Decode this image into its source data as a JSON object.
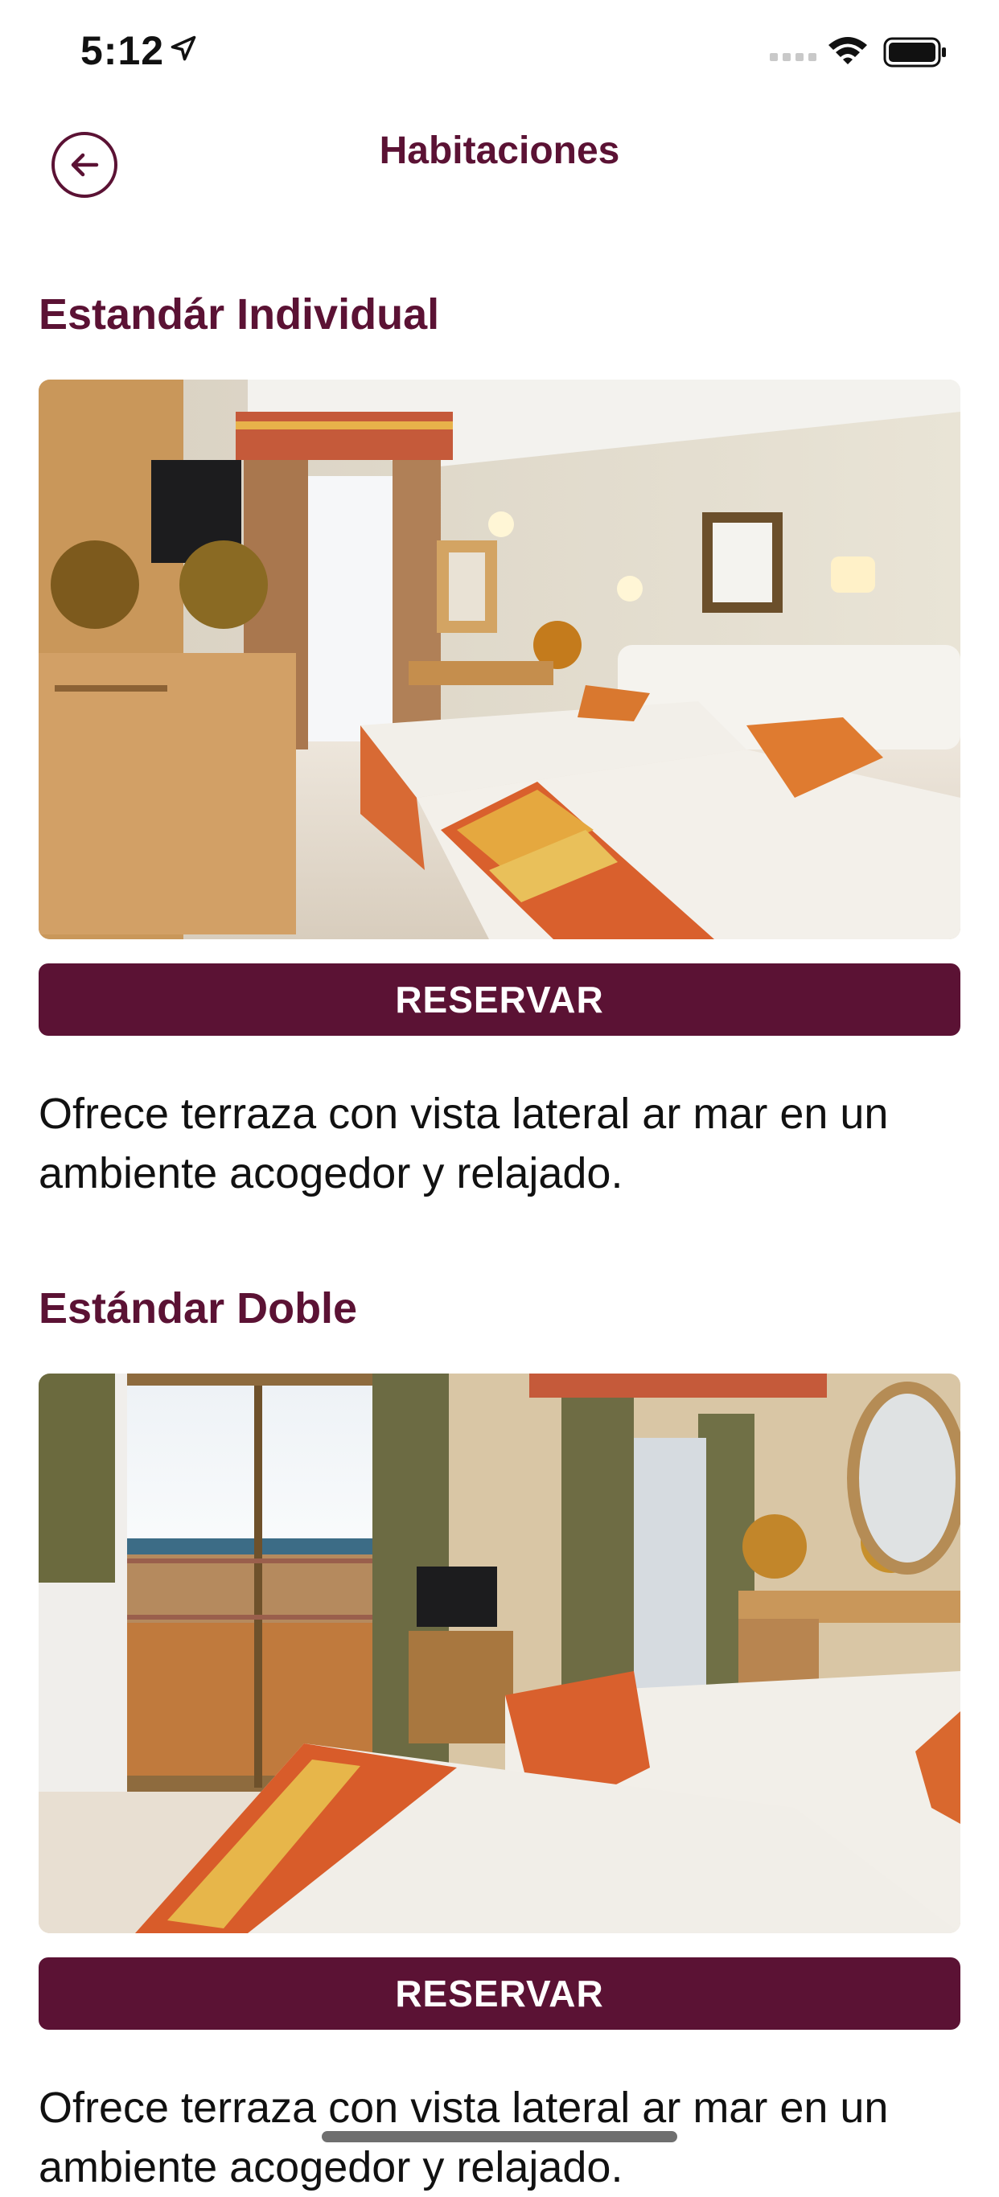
{
  "status_bar": {
    "time": "5:12",
    "icons": [
      "location-arrow-icon",
      "cellular-signal-icon",
      "wifi-icon",
      "battery-icon"
    ]
  },
  "header": {
    "title": "Habitaciones",
    "back_icon": "back-arrow-circle-icon"
  },
  "rooms": [
    {
      "title": "Estandár Individual",
      "button_label": "RESERVAR",
      "description": "Ofrece terraza con vista lateral ar mar en un ambiente acogedor y relajado."
    },
    {
      "title": "Estándar Doble",
      "button_label": "RESERVAR",
      "description": "Ofrece terraza con vista lateral ar mar en un ambiente acogedor y relajado."
    }
  ],
  "colors": {
    "accent": "#5b1234",
    "text": "#111111",
    "background": "#ffffff"
  }
}
